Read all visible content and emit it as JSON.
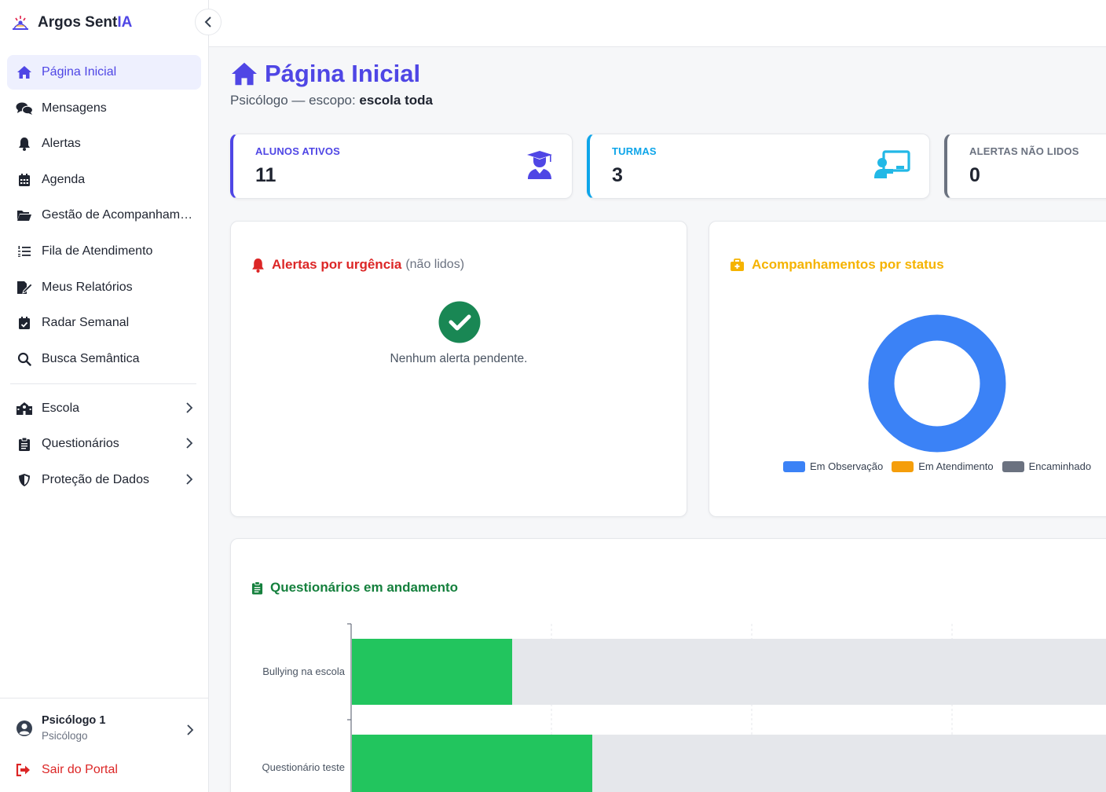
{
  "brand": {
    "name_prefix": "Argos Sent",
    "name_accent": "IA",
    "accent_color": "#4f46e5"
  },
  "sidebar": {
    "items": [
      {
        "label": "Página Inicial",
        "icon": "home-icon",
        "active": true
      },
      {
        "label": "Mensagens",
        "icon": "comments-icon"
      },
      {
        "label": "Alertas",
        "icon": "bell-icon"
      },
      {
        "label": "Agenda",
        "icon": "calendar-icon"
      },
      {
        "label": "Gestão de Acompanhame…",
        "icon": "folder-open-icon"
      },
      {
        "label": "Fila de Atendimento",
        "icon": "list-ordered-icon"
      },
      {
        "label": "Meus Relatórios",
        "icon": "edit-report-icon"
      },
      {
        "label": "Radar Semanal",
        "icon": "calendar-check-icon"
      },
      {
        "label": "Busca Semântica",
        "icon": "search-icon"
      }
    ],
    "groups": [
      {
        "label": "Escola",
        "icon": "school-icon"
      },
      {
        "label": "Questionários",
        "icon": "clipboard-icon"
      },
      {
        "label": "Proteção de Dados",
        "icon": "shield-icon"
      }
    ],
    "user": {
      "name": "Psicólogo 1",
      "role": "Psicólogo"
    },
    "logout_label": "Sair do Portal"
  },
  "header": {
    "title": "Página Inicial",
    "subtitle_prefix": "Psicólogo — escopo: ",
    "subtitle_scope": "escola toda"
  },
  "stats": [
    {
      "label": "ALUNOS ATIVOS",
      "value": "11",
      "color": "#4f46e5",
      "icon": "user-graduate-icon"
    },
    {
      "label": "TURMAS",
      "value": "3",
      "color": "#0ea5e9",
      "icon": "chalkboard-teacher-icon"
    },
    {
      "label": "ALERTAS NÃO LIDOS",
      "value": "0",
      "color": "#6b7280",
      "icon": "bell-icon"
    }
  ],
  "alerts_panel": {
    "title": "Alertas por urgência",
    "title_note": "(não lidos)",
    "empty_text": "Nenhum alerta pendente.",
    "color": "#dc2626"
  },
  "status_panel": {
    "title": "Acompanhamentos por status",
    "color": "#f5b301"
  },
  "questionnaires_panel": {
    "title": "Questionários em andamento",
    "color": "#15803d"
  },
  "chart_data": [
    {
      "type": "pie",
      "title": "Acompanhamentos por status",
      "categories": [
        "Em Observação",
        "Em Atendimento",
        "Encaminhado"
      ],
      "values": [
        1,
        0,
        0
      ],
      "colors": [
        "#3b82f6",
        "#f59e0b",
        "#6b7280"
      ],
      "legend": "bottom"
    },
    {
      "type": "bar",
      "title": "Questionários em andamento",
      "orientation": "horizontal",
      "categories": [
        "Bullying na escola",
        "Questionário teste"
      ],
      "values": [
        20,
        30
      ],
      "xlim": [
        0,
        100
      ],
      "colors": {
        "fill": "#22c55e",
        "track": "#e5e7eb"
      },
      "grid": true
    }
  ]
}
